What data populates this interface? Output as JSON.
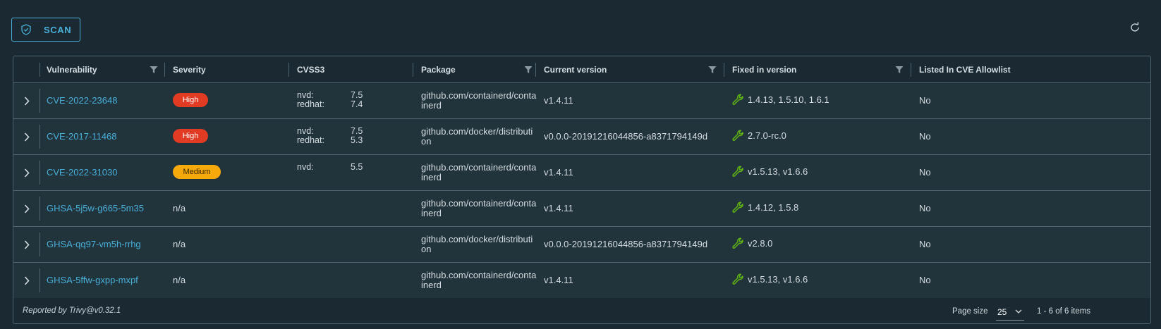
{
  "toolbar": {
    "scan_label": "SCAN",
    "scan_icon": "shield-check-icon",
    "refresh_icon": "refresh-icon"
  },
  "columns": [
    {
      "label": "Vulnerability",
      "filter": true
    },
    {
      "label": "Severity",
      "filter": false
    },
    {
      "label": "CVSS3",
      "filter": false
    },
    {
      "label": "Package",
      "filter": true
    },
    {
      "label": "Current version",
      "filter": true
    },
    {
      "label": "Fixed in version",
      "filter": true
    },
    {
      "label": "Listed In CVE Allowlist",
      "filter": false
    }
  ],
  "rows": [
    {
      "vulnerability": "CVE-2022-23648",
      "severity": "High",
      "cvss": [
        {
          "source": "nvd:",
          "score": "7.5"
        },
        {
          "source": "redhat:",
          "score": "7.4"
        }
      ],
      "package": "github.com/containerd/containerd",
      "current_version": "v1.4.11",
      "fixed_version": "1.4.13, 1.5.10, 1.6.1",
      "allowlisted": "No"
    },
    {
      "vulnerability": "CVE-2017-11468",
      "severity": "High",
      "cvss": [
        {
          "source": "nvd:",
          "score": "7.5"
        },
        {
          "source": "redhat:",
          "score": "5.3"
        }
      ],
      "package": "github.com/docker/distribution",
      "current_version": "v0.0.0-20191216044856-a8371794149d",
      "fixed_version": "2.7.0-rc.0",
      "allowlisted": "No"
    },
    {
      "vulnerability": "CVE-2022-31030",
      "severity": "Medium",
      "cvss": [
        {
          "source": "nvd:",
          "score": "5.5"
        }
      ],
      "package": "github.com/containerd/containerd",
      "current_version": "v1.4.11",
      "fixed_version": "v1.5.13, v1.6.6",
      "allowlisted": "No"
    },
    {
      "vulnerability": "GHSA-5j5w-g665-5m35",
      "severity": "n/a",
      "cvss": [],
      "package": "github.com/containerd/containerd",
      "current_version": "v1.4.11",
      "fixed_version": "1.4.12, 1.5.8",
      "allowlisted": "No"
    },
    {
      "vulnerability": "GHSA-qq97-vm5h-rrhg",
      "severity": "n/a",
      "cvss": [],
      "package": "github.com/docker/distribution",
      "current_version": "v0.0.0-20191216044856-a8371794149d",
      "fixed_version": "v2.8.0",
      "allowlisted": "No"
    },
    {
      "vulnerability": "GHSA-5ffw-gxpp-mxpf",
      "severity": "n/a",
      "cvss": [],
      "package": "github.com/containerd/containerd",
      "current_version": "v1.4.11",
      "fixed_version": "v1.5.13, v1.6.6",
      "allowlisted": "No"
    }
  ],
  "footer": {
    "reported_by": "Reported by Trivy@v0.32.1",
    "page_size_label": "Page size",
    "page_size": "25",
    "count": "1 - 6 of 6 items"
  },
  "colors": {
    "background": "#1b2a32",
    "link": "#49afd9",
    "high": "#e13b23",
    "medium": "#f6a90b",
    "wrench": "#60b515"
  }
}
